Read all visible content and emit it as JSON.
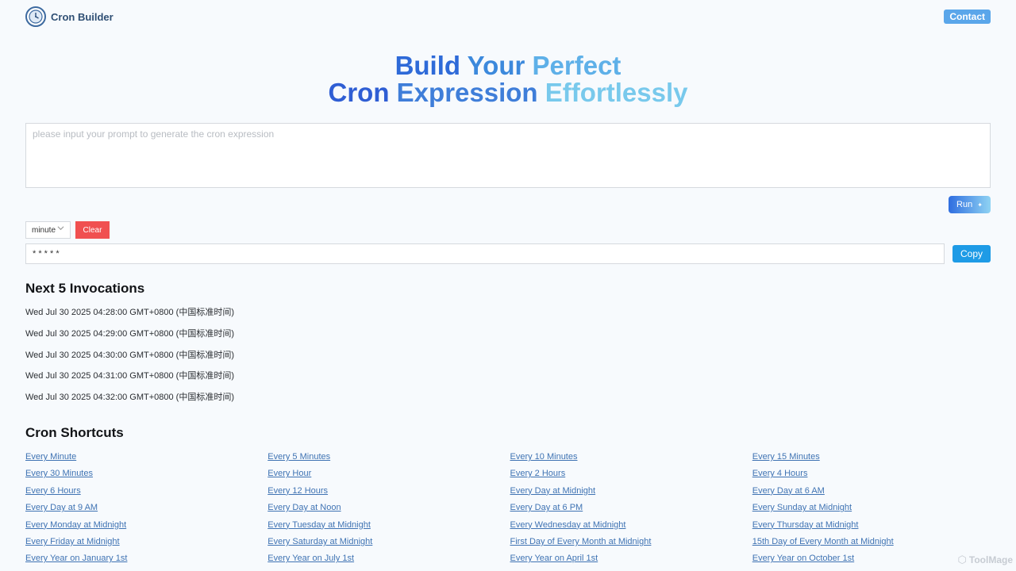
{
  "header": {
    "brand": "Cron Builder",
    "contact_label": "Contact"
  },
  "hero": {
    "line1": [
      "Build",
      "Your",
      "Perfect"
    ],
    "line2": [
      "Cron",
      "Expression",
      "Effortlessly"
    ]
  },
  "prompt": {
    "placeholder": "please input your prompt to generate the cron expression",
    "value": ""
  },
  "run_label": "Run",
  "unit_select": {
    "value": "minute"
  },
  "clear_label": "Clear",
  "cron": {
    "value": "* * * * *"
  },
  "copy_label": "Copy",
  "invocations": {
    "title": "Next 5 Invocations",
    "items": [
      "Wed Jul 30 2025 04:28:00 GMT+0800 (中国标准时间)",
      "Wed Jul 30 2025 04:29:00 GMT+0800 (中国标准时间)",
      "Wed Jul 30 2025 04:30:00 GMT+0800 (中国标准时间)",
      "Wed Jul 30 2025 04:31:00 GMT+0800 (中国标准时间)",
      "Wed Jul 30 2025 04:32:00 GMT+0800 (中国标准时间)"
    ]
  },
  "shortcuts": {
    "title": "Cron Shortcuts",
    "items": [
      "Every Minute",
      "Every 5 Minutes",
      "Every 10 Minutes",
      "Every 15 Minutes",
      "Every 30 Minutes",
      "Every Hour",
      "Every 2 Hours",
      "Every 4 Hours",
      "Every 6 Hours",
      "Every 12 Hours",
      "Every Day at Midnight",
      "Every Day at 6 AM",
      "Every Day at 9 AM",
      "Every Day at Noon",
      "Every Day at 6 PM",
      "Every Sunday at Midnight",
      "Every Monday at Midnight",
      "Every Tuesday at Midnight",
      "Every Wednesday at Midnight",
      "Every Thursday at Midnight",
      "Every Friday at Midnight",
      "Every Saturday at Midnight",
      "First Day of Every Month at Midnight",
      "15th Day of Every Month at Midnight",
      "Every Year on January 1st",
      "Every Year on July 1st",
      "Every Year on April 1st",
      "Every Year on October 1st"
    ]
  },
  "watermark": "ToolMage",
  "icons": {
    "logo": "clock-icon",
    "select": "chevron-down-icon",
    "run": "sparkle-icon",
    "watermark": "toolmage-logo-icon"
  }
}
